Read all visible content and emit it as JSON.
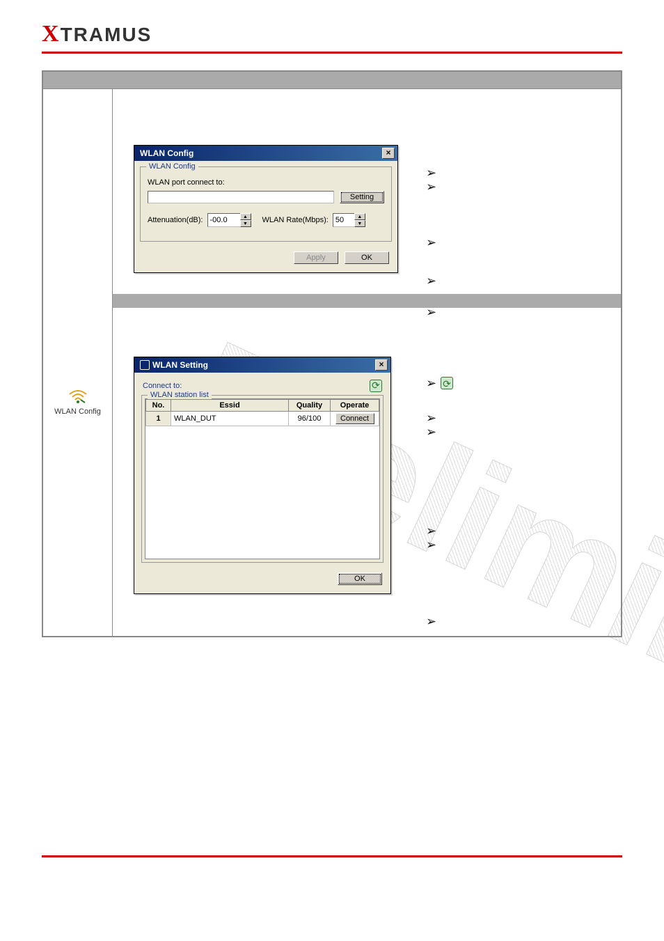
{
  "logo": {
    "x": "X",
    "rest": "TRAMUS"
  },
  "sidebar": {
    "label": "WLAN Config"
  },
  "dialog1": {
    "title": "WLAN Config",
    "fieldset_legend": "WLAN Config",
    "port_label": "WLAN port connect to:",
    "port_value": "",
    "setting_btn": "Setting",
    "atten_label": "Attenuation(dB):",
    "atten_value": "-00.0",
    "rate_label": "WLAN Rate(Mbps):",
    "rate_value": "50",
    "apply_btn": "Apply",
    "ok_btn": "OK"
  },
  "dialog2": {
    "title": "WLAN Setting",
    "connect_label": "Connect to:",
    "fieldset_legend": "WLAN station list",
    "columns": {
      "no": "No.",
      "essid": "Essid",
      "quality": "Quality",
      "operate": "Operate"
    },
    "rows": [
      {
        "no": "1",
        "essid": "WLAN_DUT",
        "quality": "96/100",
        "operate": "Connect"
      }
    ],
    "ok_btn": "OK"
  },
  "arrows": {
    "glyph": "➢"
  }
}
